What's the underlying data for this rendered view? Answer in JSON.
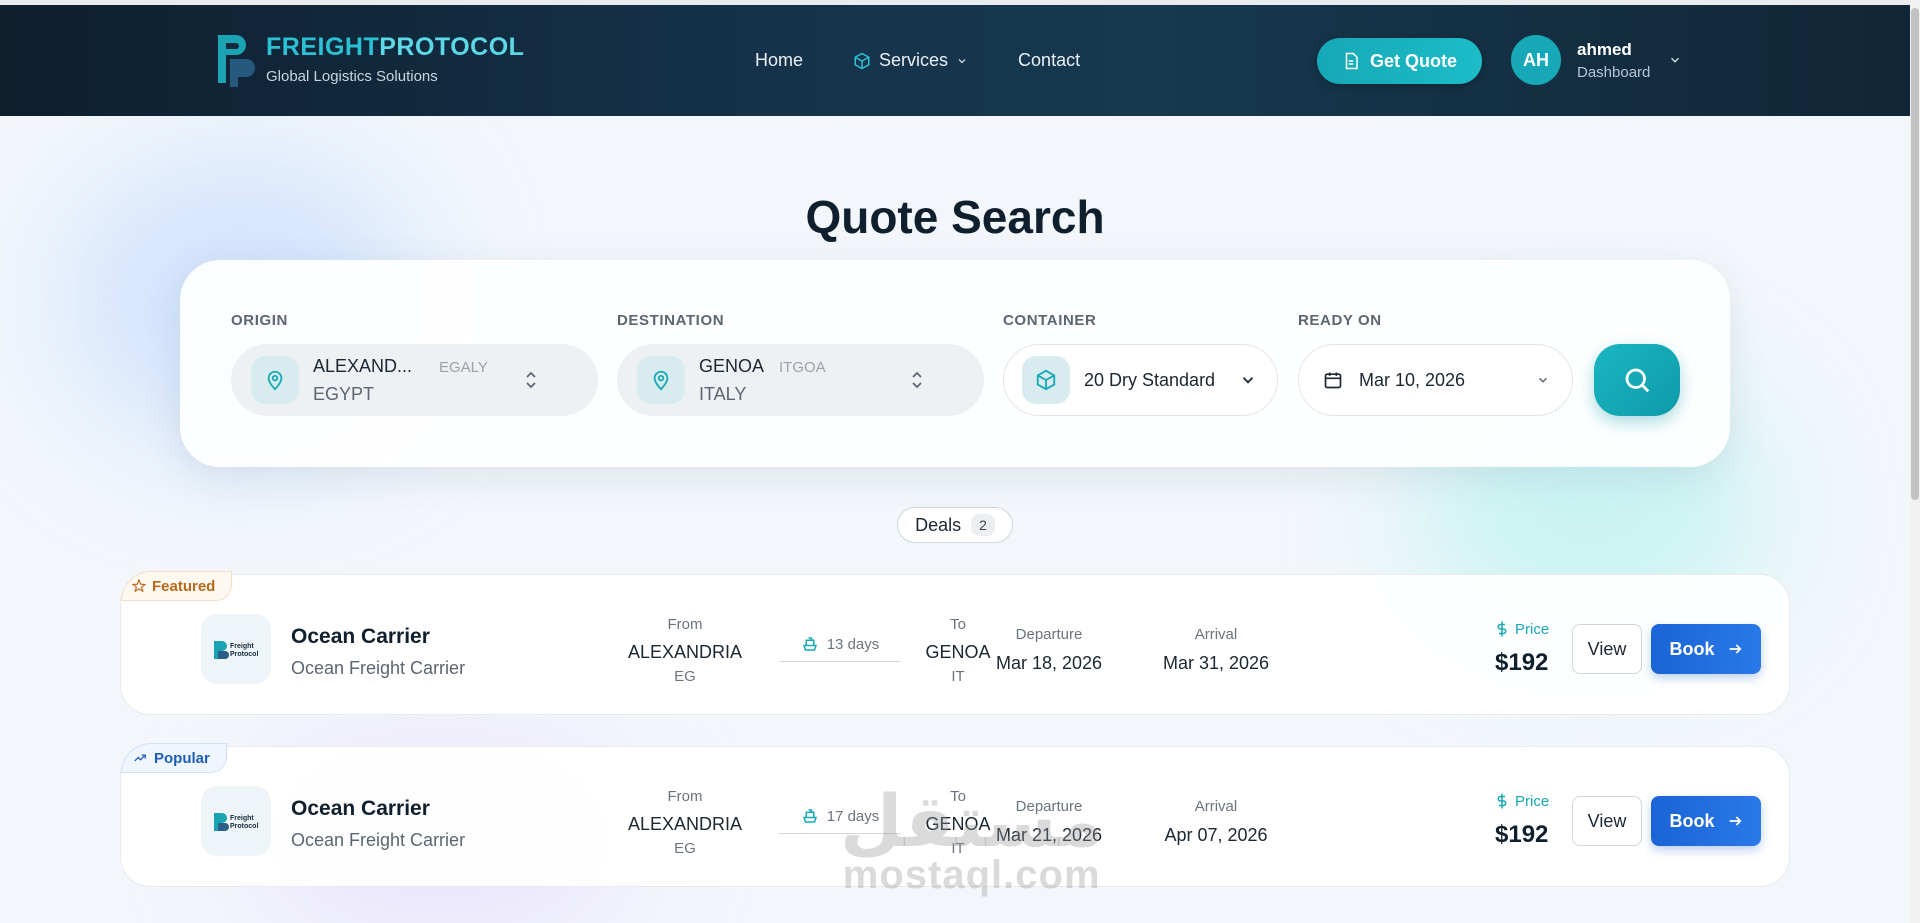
{
  "colors": {
    "accent": "#16a8b6",
    "header_bg": "#132b3e",
    "book_blue": "#1a64d6",
    "featured": "#b86a1a",
    "popular": "#1d5fb8"
  },
  "brand": {
    "name_part1": "FREIGHT",
    "name_part2": "PROTOCOL",
    "tagline": "Global Logistics Solutions"
  },
  "nav": {
    "home": "Home",
    "services": "Services",
    "contact": "Contact"
  },
  "header": {
    "quote_button": "Get Quote",
    "avatar_initials": "AH",
    "user_name": "ahmed",
    "user_role": "Dashboard"
  },
  "page": {
    "title": "Quote Search"
  },
  "search": {
    "origin_label": "ORIGIN",
    "origin": {
      "city": "ALEXAND...",
      "code": "EGALY",
      "country": "EGYPT"
    },
    "destination_label": "DESTINATION",
    "destination": {
      "city": "GENOA",
      "code": "ITGOA",
      "country": "ITALY"
    },
    "container_label": "CONTAINER",
    "container_value": "20 Dry Standard",
    "ready_label": "READY ON",
    "ready_value": "Mar 10, 2026"
  },
  "deals": {
    "label": "Deals",
    "count": "2",
    "items": [
      {
        "tag": "Featured",
        "carrier": "Ocean Carrier",
        "carrier_type": "Ocean Freight Carrier",
        "from_label": "From",
        "from_city": "ALEXANDRIA",
        "from_cc": "EG",
        "duration": "13 days",
        "to_label": "To",
        "to_city": "GENOA",
        "to_cc": "IT",
        "departure_label": "Departure",
        "departure": "Mar 18, 2026",
        "arrival_label": "Arrival",
        "arrival": "Mar 31, 2026",
        "price_label": "Price",
        "price": "$192",
        "view": "View",
        "book": "Book"
      },
      {
        "tag": "Popular",
        "carrier": "Ocean Carrier",
        "carrier_type": "Ocean Freight Carrier",
        "from_label": "From",
        "from_city": "ALEXANDRIA",
        "from_cc": "EG",
        "duration": "17 days",
        "to_label": "To",
        "to_city": "GENOA",
        "to_cc": "IT",
        "departure_label": "Departure",
        "departure": "Mar 21, 2026",
        "arrival_label": "Arrival",
        "arrival": "Apr 07, 2026",
        "price_label": "Price",
        "price": "$192",
        "view": "View",
        "book": "Book"
      }
    ]
  },
  "watermark": {
    "arabic": "مستقل",
    "latin": "mostaql.com"
  }
}
